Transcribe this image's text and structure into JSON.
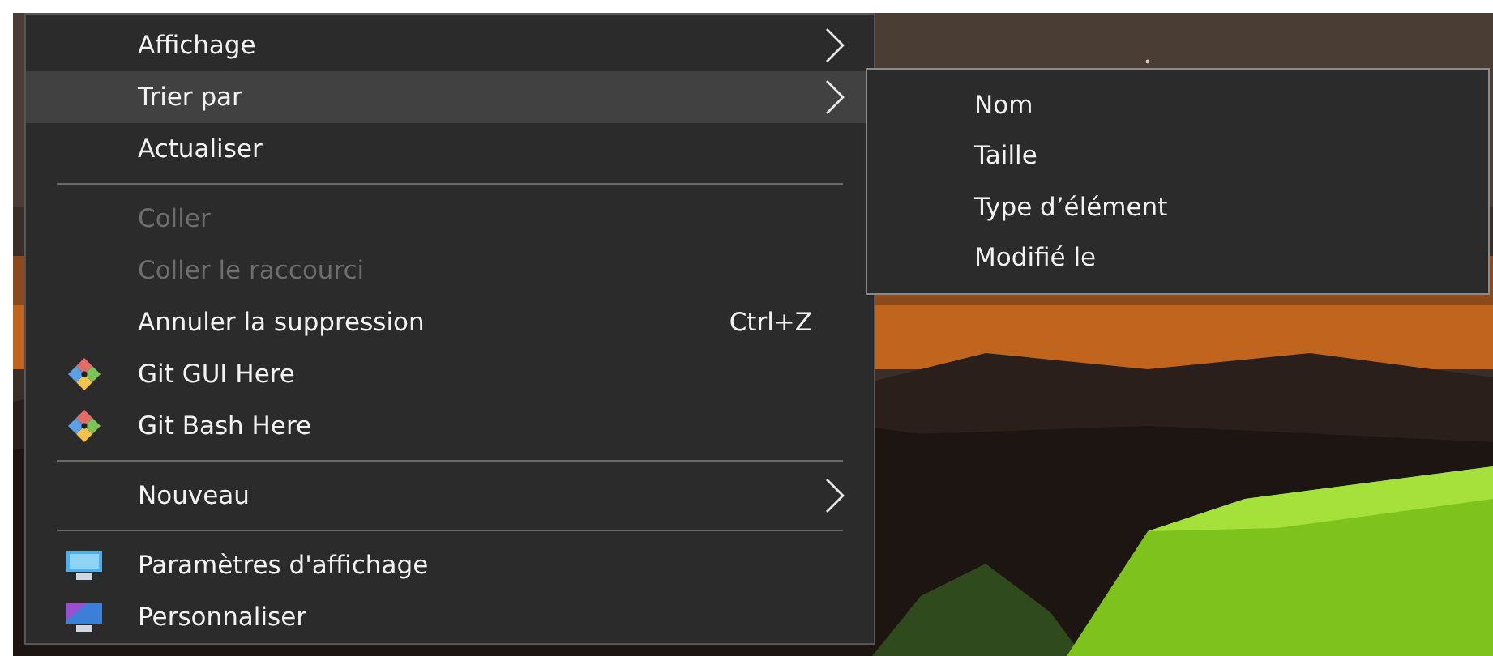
{
  "context_menu": {
    "items": [
      {
        "kind": "item",
        "label": "Affichage",
        "submenu": true,
        "selected": false,
        "disabled": false
      },
      {
        "kind": "item",
        "label": "Trier par",
        "submenu": true,
        "selected": true,
        "disabled": false
      },
      {
        "kind": "item",
        "label": "Actualiser",
        "selected": false,
        "disabled": false
      },
      {
        "kind": "separator"
      },
      {
        "kind": "item",
        "label": "Coller",
        "selected": false,
        "disabled": true
      },
      {
        "kind": "item",
        "label": "Coller le raccourci",
        "selected": false,
        "disabled": true
      },
      {
        "kind": "item",
        "label": "Annuler la suppression",
        "shortcut": "Ctrl+Z",
        "selected": false,
        "disabled": false
      },
      {
        "kind": "git",
        "label": "Git GUI Here",
        "selected": false,
        "disabled": false
      },
      {
        "kind": "git",
        "label": "Git Bash Here",
        "selected": false,
        "disabled": false
      },
      {
        "kind": "separator"
      },
      {
        "kind": "item",
        "label": "Nouveau",
        "submenu": true,
        "selected": false,
        "disabled": false
      },
      {
        "kind": "separator"
      },
      {
        "kind": "display",
        "label": "Paramètres d'affichage",
        "selected": false,
        "disabled": false
      },
      {
        "kind": "personalize",
        "label": "Personnaliser",
        "selected": false,
        "disabled": false
      }
    ]
  },
  "submenu": {
    "items": [
      {
        "label": "Nom",
        "selected": false
      },
      {
        "label": "Taille",
        "selected": false
      },
      {
        "label": "Type d’élément",
        "selected": false
      },
      {
        "label": "Modifié le",
        "selected": false
      }
    ]
  }
}
